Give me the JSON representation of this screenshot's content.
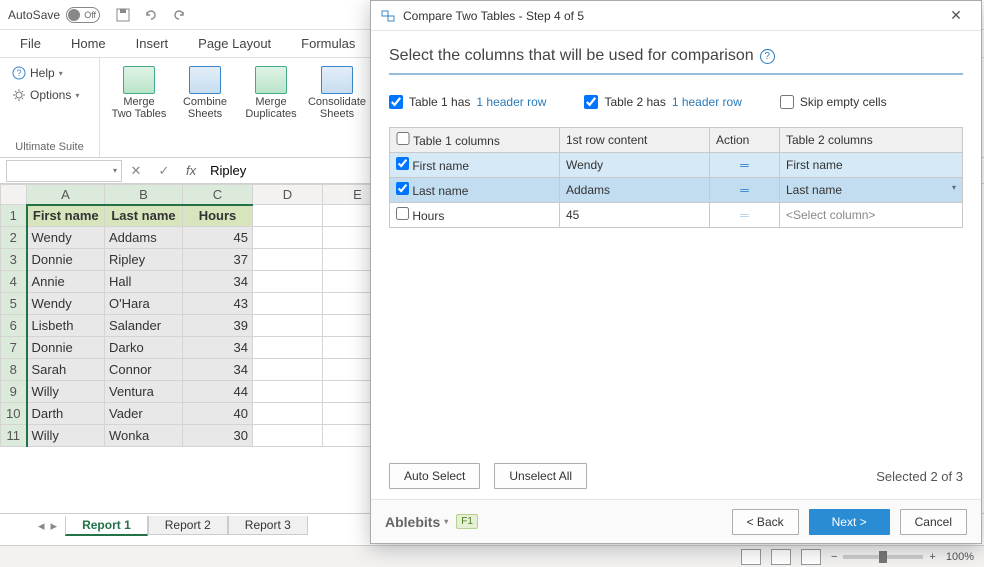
{
  "titlebar": {
    "autosave_label": "AutoSave",
    "autosave_state": "Off"
  },
  "menu_tabs": [
    "File",
    "Home",
    "Insert",
    "Page Layout",
    "Formulas"
  ],
  "ribbon": {
    "help_label": "Help",
    "options_label": "Options",
    "group_label": "Ultimate Suite",
    "large_buttons": [
      {
        "label": "Merge\nTwo Tables"
      },
      {
        "label": "Combine\nSheets"
      },
      {
        "label": "Merge\nDuplicates"
      },
      {
        "label": "Consolidate\nSheets"
      }
    ]
  },
  "formula": {
    "namebox": "",
    "fx": "fx",
    "value": "Ripley"
  },
  "sheet": {
    "columns": [
      "A",
      "B",
      "C",
      "D",
      "E"
    ],
    "headers": [
      "First name",
      "Last name",
      "Hours"
    ],
    "rows": [
      [
        "Wendy",
        "Addams",
        "45"
      ],
      [
        "Donnie",
        "Ripley",
        "37"
      ],
      [
        "Annie",
        "Hall",
        "34"
      ],
      [
        "Wendy",
        "O'Hara",
        "43"
      ],
      [
        "Lisbeth",
        "Salander",
        "39"
      ],
      [
        "Donnie",
        "Darko",
        "34"
      ],
      [
        "Sarah",
        "Connor",
        "34"
      ],
      [
        "Willy",
        "Ventura",
        "44"
      ],
      [
        "Darth",
        "Vader",
        "40"
      ],
      [
        "Willy",
        "Wonka",
        "30"
      ]
    ],
    "tabs": [
      "Report 1",
      "Report 2",
      "Report 3"
    ],
    "active_tab": 0
  },
  "statusbar": {
    "zoom": "100%"
  },
  "dialog": {
    "title": "Compare Two Tables - Step 4 of 5",
    "heading": "Select the columns that will be used for comparison",
    "option1_prefix": "Table 1  has",
    "option1_link": "1 header row",
    "option2_prefix": "Table 2 has",
    "option2_link": "1 header row",
    "option3": "Skip empty cells",
    "table": {
      "headers": [
        "Table 1 columns",
        "1st row content",
        "Action",
        "Table 2 columns"
      ],
      "rows": [
        {
          "checked": true,
          "c1": "First name",
          "c2": "Wendy",
          "action": "=",
          "c4": "First name",
          "has_dd": false,
          "cls": "row-sel"
        },
        {
          "checked": true,
          "c1": "Last name",
          "c2": "Addams",
          "action": "=",
          "c4": "Last name",
          "has_dd": true,
          "cls": "row-hov"
        },
        {
          "checked": false,
          "c1": "Hours",
          "c2": "45",
          "action": "=",
          "c4": "<Select column>",
          "has_dd": false,
          "cls": ""
        }
      ]
    },
    "auto_select": "Auto Select",
    "unselect_all": "Unselect All",
    "selected_info": "Selected 2 of 3",
    "brand": "Ablebits",
    "f1": "F1",
    "back": "< Back",
    "next": "Next >",
    "cancel": "Cancel"
  },
  "chart_data": null
}
